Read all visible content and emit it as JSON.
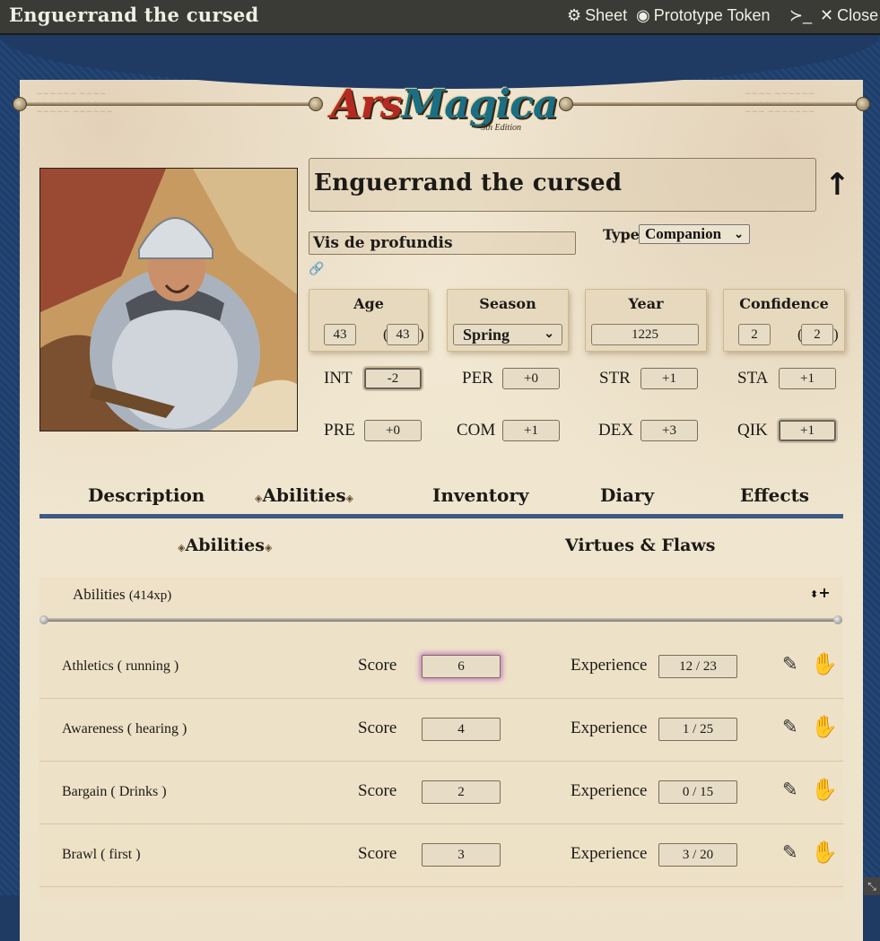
{
  "window": {
    "title": "Enguerrand the cursed",
    "controls": [
      {
        "icon": "gear-icon",
        "glyph": "⚙",
        "label": "Sheet"
      },
      {
        "icon": "user-circle-icon",
        "glyph": "◉",
        "label": "Prototype Token"
      },
      {
        "icon": "terminal-icon",
        "glyph": "≻_",
        "label": ""
      },
      {
        "icon": "close-icon",
        "glyph": "✕",
        "label": "Close"
      }
    ]
  },
  "logo": {
    "text_a": "Ars",
    "text_b": "Magica",
    "edition": "5th Edition"
  },
  "character": {
    "name": "Enguerrand the cursed",
    "covenant": "Vis de profundis",
    "type_label": "Type",
    "type_value": "Companion"
  },
  "stats": {
    "age": {
      "title": "Age",
      "value": "43",
      "apparent": "43"
    },
    "season": {
      "title": "Season",
      "value": "Spring"
    },
    "year": {
      "title": "Year",
      "value": "1225"
    },
    "confidence": {
      "title": "Confidence",
      "value": "2",
      "max": "2"
    }
  },
  "characteristics": [
    {
      "label": "INT",
      "value": "-2"
    },
    {
      "label": "PER",
      "value": "+0"
    },
    {
      "label": "STR",
      "value": "+1"
    },
    {
      "label": "STA",
      "value": "+1"
    },
    {
      "label": "PRE",
      "value": "+0"
    },
    {
      "label": "COM",
      "value": "+1"
    },
    {
      "label": "DEX",
      "value": "+3"
    },
    {
      "label": "QIK",
      "value": "+1"
    }
  ],
  "tabs": [
    "Description",
    "Abilities",
    "Inventory",
    "Diary",
    "Effects"
  ],
  "active_tab": "Abilities",
  "subtabs": [
    "Abilities",
    "Virtues & Flaws"
  ],
  "abilities": {
    "header": "Abilities",
    "xp": "(414xp)",
    "score_label": "Score",
    "exp_label": "Experience",
    "rows": [
      {
        "name": "Athletics ( running )",
        "score": "6",
        "exp": "12 / 23"
      },
      {
        "name": "Awareness ( hearing )",
        "score": "4",
        "exp": "1 / 25"
      },
      {
        "name": "Bargain ( Drinks )",
        "score": "2",
        "exp": "0 / 15"
      },
      {
        "name": "Brawl ( first )",
        "score": "3",
        "exp": "3 / 20"
      }
    ]
  },
  "colors": {
    "frame": "#1f3a63",
    "parchment": "#efe5cf",
    "tab_bar": "#3c5a84",
    "focus_glow": "#c67ac4"
  }
}
